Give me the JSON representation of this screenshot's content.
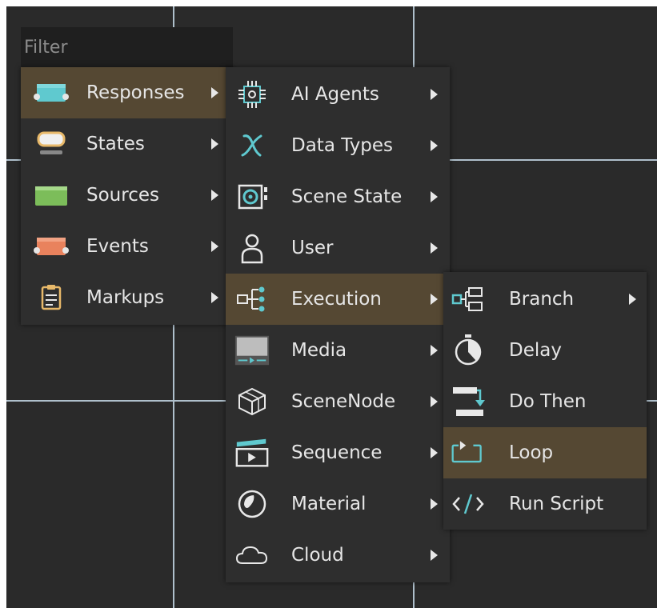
{
  "filter": {
    "placeholder": "Filter"
  },
  "menu1": {
    "items": [
      {
        "label": "Responses",
        "icon": "responses-node-icon",
        "highlighted": true
      },
      {
        "label": "States",
        "icon": "states-node-icon"
      },
      {
        "label": "Sources",
        "icon": "sources-node-icon"
      },
      {
        "label": "Events",
        "icon": "events-node-icon"
      },
      {
        "label": "Markups",
        "icon": "clipboard-icon"
      }
    ]
  },
  "menu2": {
    "items": [
      {
        "label": "AI Agents",
        "icon": "chip-icon"
      },
      {
        "label": "Data Types",
        "icon": "variable-x-icon"
      },
      {
        "label": "Scene State",
        "icon": "scene-state-icon"
      },
      {
        "label": "User",
        "icon": "user-icon"
      },
      {
        "label": "Execution",
        "icon": "execution-flow-icon",
        "highlighted": true
      },
      {
        "label": "Media",
        "icon": "media-player-icon"
      },
      {
        "label": "SceneNode",
        "icon": "cube-icon"
      },
      {
        "label": "Sequence",
        "icon": "sequence-clapper-icon"
      },
      {
        "label": "Material",
        "icon": "material-sphere-icon"
      },
      {
        "label": "Cloud",
        "icon": "cloud-icon"
      }
    ]
  },
  "menu3": {
    "items": [
      {
        "label": "Branch",
        "icon": "branch-icon",
        "has_submenu": true
      },
      {
        "label": "Delay",
        "icon": "stopwatch-icon"
      },
      {
        "label": "Do Then",
        "icon": "do-then-icon"
      },
      {
        "label": "Loop",
        "icon": "loop-icon",
        "highlighted": true
      },
      {
        "label": "Run Script",
        "icon": "code-tag-icon"
      }
    ]
  },
  "colors": {
    "canvas": "#2a2a2a",
    "menu_bg": "#2e2e2e",
    "highlight": "#554833",
    "accent_teal": "#5fc9cf",
    "text": "#e6e6e6"
  }
}
